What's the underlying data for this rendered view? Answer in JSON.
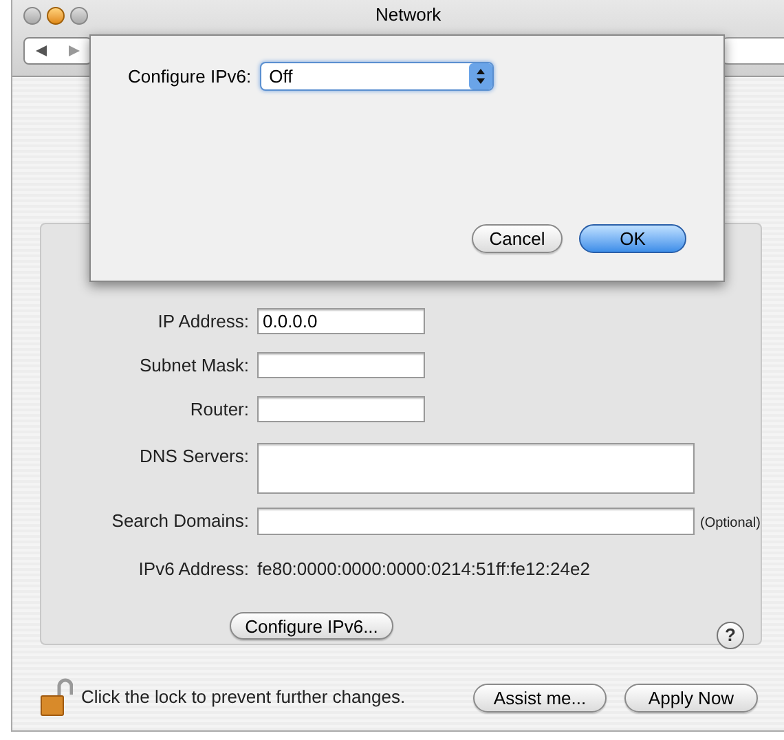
{
  "window": {
    "title": "Network"
  },
  "sheet": {
    "label": "Configure IPv6:",
    "select_value": "Off",
    "buttons": [
      {
        "label": "Cancel",
        "kind": "normal"
      },
      {
        "label": "OK",
        "kind": "default"
      }
    ]
  },
  "fields": [
    {
      "label": "IP Address:",
      "value": "0.0.0.0",
      "kind": "short"
    },
    {
      "label": "Subnet Mask:",
      "kind": "short"
    },
    {
      "label": "Router:",
      "kind": "short"
    },
    {
      "label": "DNS Servers:",
      "kind": "area"
    },
    {
      "label": "Search Domains:",
      "kind": "wide",
      "note": "(Optional)"
    }
  ],
  "ipv6": {
    "label": "IPv6 Address:",
    "value": "fe80:0000:0000:0000:0214:51ff:fe12:24e2"
  },
  "configure_button": "Configure IPv6...",
  "help": "?",
  "lock": {
    "text": "Click the lock to prevent further changes.",
    "locked": false
  },
  "buttons": [
    "Assist me...",
    "Apply Now"
  ]
}
